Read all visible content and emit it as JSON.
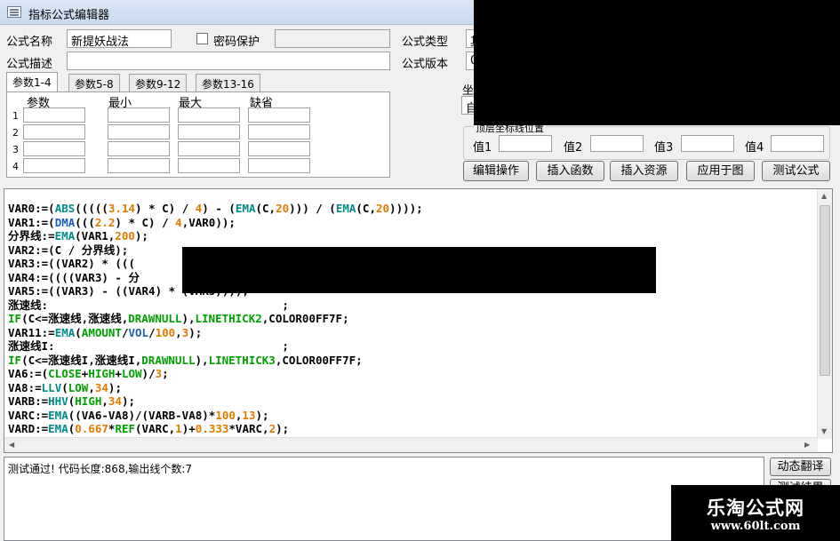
{
  "window": {
    "title": "指标公式编辑器"
  },
  "form": {
    "name_label": "公式名称",
    "name_value": "新提妖战法",
    "password_label": "密码保护",
    "desc_label": "公式描述",
    "desc_value": "",
    "type_label": "公式类型",
    "type_value": "其",
    "version_label": "公式版本",
    "version_value": "0",
    "coord_label": "坐",
    "coord_value": "自"
  },
  "tabs": [
    "参数1-4",
    "参数5-8",
    "参数9-12",
    "参数13-16"
  ],
  "param_table": {
    "headers": [
      "参数",
      "最小",
      "最大",
      "缺省"
    ],
    "rows": [
      "1",
      "2",
      "3",
      "4"
    ]
  },
  "axis_group": {
    "title": "顶层坐标线位置",
    "labels": [
      "值1",
      "值2",
      "值3",
      "值4"
    ]
  },
  "buttons": [
    "编辑操作",
    "插入函数",
    "插入资源",
    "应用于图",
    "测试公式"
  ],
  "code_lines": [
    [
      [
        "VAR0:=(",
        ""
      ],
      [
        "ABS",
        "k"
      ],
      [
        "(((((",
        ""
      ],
      [
        "3.14",
        "n"
      ],
      [
        ") * C) / ",
        ""
      ],
      [
        "4",
        "n"
      ],
      [
        ") - (",
        ""
      ],
      [
        "EMA",
        "k"
      ],
      [
        "(C,",
        ""
      ],
      [
        "20",
        "n"
      ],
      [
        "))) / (",
        ""
      ],
      [
        "EMA",
        "k"
      ],
      [
        "(C,",
        ""
      ],
      [
        "20",
        "n"
      ],
      [
        "))));",
        ""
      ]
    ],
    [
      [
        "VAR1:=(",
        ""
      ],
      [
        "DMA",
        "b"
      ],
      [
        "(((",
        ""
      ],
      [
        "2.2",
        "n"
      ],
      [
        ") * C) / ",
        ""
      ],
      [
        "4",
        "n"
      ],
      [
        ",VAR0));",
        ""
      ]
    ],
    [
      [
        "分界线:=",
        ""
      ],
      [
        "EMA",
        "k"
      ],
      [
        "(VAR1,",
        ""
      ],
      [
        "200",
        "n"
      ],
      [
        ");",
        ""
      ]
    ],
    [
      [
        "VAR2:=(C / 分界线);",
        ""
      ]
    ],
    [
      [
        "VAR3:=((VAR2) * (((",
        ""
      ]
    ],
    [
      [
        "VAR4:=((((VAR3) - 分",
        ""
      ]
    ],
    [
      [
        "VAR5:=((VAR3) - ((VAR4) * (VAR5))));",
        ""
      ]
    ],
    [
      [
        "涨速线:                                   ;",
        ""
      ]
    ],
    [
      [
        "IF",
        "g"
      ],
      [
        "(C<=涨速线,涨速线,",
        ""
      ],
      [
        "DRAWNULL",
        "g"
      ],
      [
        "),",
        ""
      ],
      [
        "LINETHICK2",
        "g"
      ],
      [
        ",COLOR00FF7F;",
        ""
      ]
    ],
    [
      [
        "VAR11:=",
        ""
      ],
      [
        "EMA",
        "k"
      ],
      [
        "(",
        ""
      ],
      [
        "AMOUNT",
        "g"
      ],
      [
        "/",
        ""
      ],
      [
        "VOL",
        "b"
      ],
      [
        "/",
        ""
      ],
      [
        "100",
        "n"
      ],
      [
        ",",
        ""
      ],
      [
        "3",
        "n"
      ],
      [
        ");",
        ""
      ]
    ],
    [
      [
        "涨速线I:                                  ;",
        ""
      ]
    ],
    [
      [
        "IF",
        "g"
      ],
      [
        "(C<=涨速线I,涨速线I,",
        ""
      ],
      [
        "DRAWNULL",
        "g"
      ],
      [
        "),",
        ""
      ],
      [
        "LINETHICK3",
        "g"
      ],
      [
        ",COLOR00FF7F;",
        ""
      ]
    ],
    [
      [
        "VA6:=(",
        ""
      ],
      [
        "CLOSE",
        "g"
      ],
      [
        "+",
        ""
      ],
      [
        "HIGH",
        "g"
      ],
      [
        "+",
        ""
      ],
      [
        "LOW",
        "g"
      ],
      [
        ")/",
        ""
      ],
      [
        "3",
        "n"
      ],
      [
        ";",
        ""
      ]
    ],
    [
      [
        "VA8:=",
        ""
      ],
      [
        "LLV",
        "k"
      ],
      [
        "(",
        ""
      ],
      [
        "LOW",
        "g"
      ],
      [
        ",",
        ""
      ],
      [
        "34",
        "n"
      ],
      [
        ");",
        ""
      ]
    ],
    [
      [
        "VARB:=",
        ""
      ],
      [
        "HHV",
        "k"
      ],
      [
        "(",
        ""
      ],
      [
        "HIGH",
        "g"
      ],
      [
        ",",
        ""
      ],
      [
        "34",
        "n"
      ],
      [
        ");",
        ""
      ]
    ],
    [
      [
        "VARC:=",
        ""
      ],
      [
        "EMA",
        "k"
      ],
      [
        "((VA6-VA8)/(VARB-VA8)*",
        ""
      ],
      [
        "100",
        "n"
      ],
      [
        ",",
        ""
      ],
      [
        "13",
        "n"
      ],
      [
        ");",
        ""
      ]
    ],
    [
      [
        "VARD:=",
        ""
      ],
      [
        "EMA",
        "k"
      ],
      [
        "(",
        ""
      ],
      [
        "0.667",
        "n"
      ],
      [
        "*",
        ""
      ],
      [
        "REF",
        "g"
      ],
      [
        "(VARC,",
        ""
      ],
      [
        "1",
        "n"
      ],
      [
        ")+",
        ""
      ],
      [
        "0.333",
        "n"
      ],
      [
        "*VARC,",
        ""
      ],
      [
        "2",
        "n"
      ],
      [
        ");",
        ""
      ]
    ]
  ],
  "status": {
    "message": "测试通过! 代码长度:868,输出线个数:7",
    "translate_button": "动态翻译",
    "second_button": "测试结果"
  },
  "watermark": {
    "name": "乐淘公式网",
    "url": "www.60lt.com"
  },
  "colors": {
    "function": "#008b8b",
    "number": "#e07b00",
    "keyword": "#00a000",
    "variable": "#1a5fb4"
  }
}
